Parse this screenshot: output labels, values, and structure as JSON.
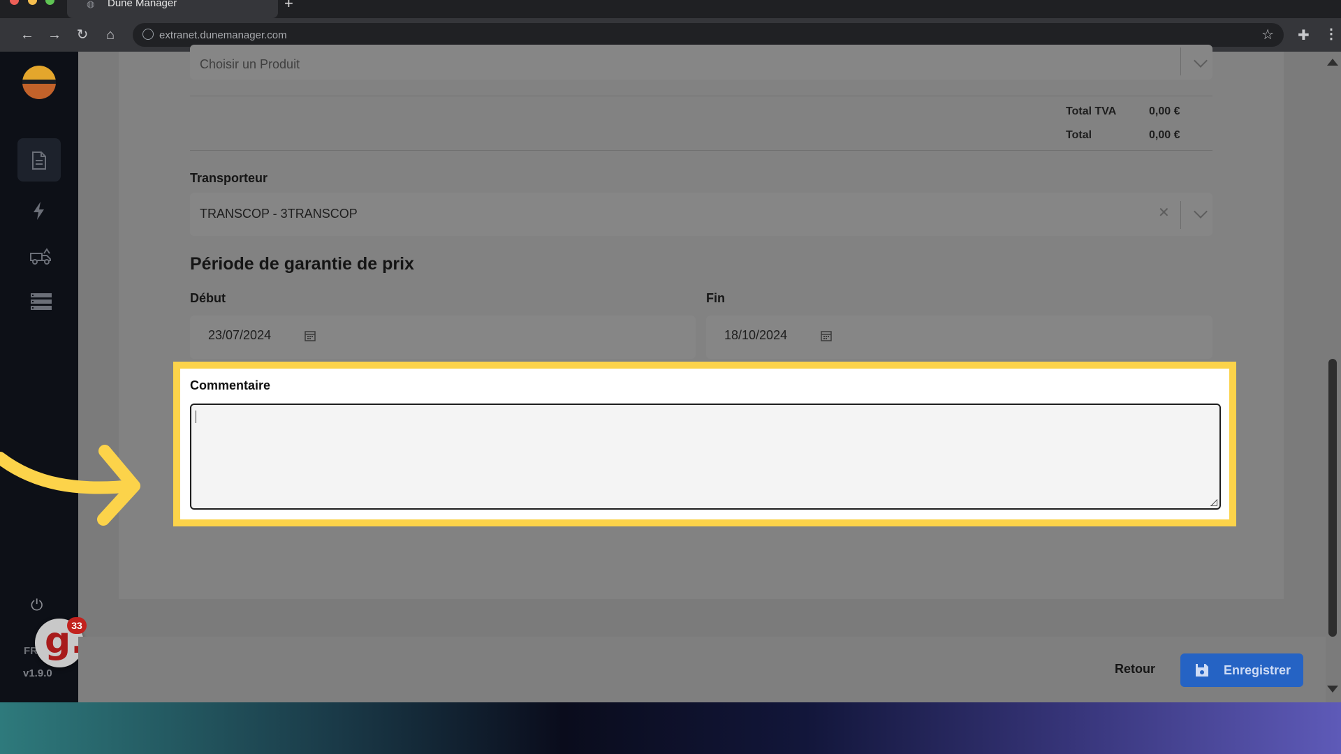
{
  "browser": {
    "tab_title": "Dune Manager",
    "new_tab_symbol": "+",
    "url": "extranet.dunemanager.com"
  },
  "sidebar": {
    "items": [
      {
        "name": "documents",
        "icon": "document-icon",
        "active": true
      },
      {
        "name": "lightning",
        "icon": "lightning-icon",
        "active": false
      },
      {
        "name": "truck",
        "icon": "truck-icon",
        "active": false
      },
      {
        "name": "list",
        "icon": "list-icon",
        "active": false
      }
    ],
    "language": "FR",
    "version": "v1.9.0",
    "badge_count": "33",
    "avatar_letter": "g."
  },
  "form": {
    "product_placeholder": "Choisir un Produit",
    "totals": [
      {
        "label": "Total TVA",
        "value": "0,00 €"
      },
      {
        "label": "Total",
        "value": "0,00 €"
      }
    ],
    "transporter_label": "Transporteur",
    "transporter_value": "TRANSCOP - 3TRANSCOP",
    "price_period_title": "Période de garantie de prix",
    "start_label": "Début",
    "start_value": "23/07/2024",
    "end_label": "Fin",
    "end_value": "18/10/2024",
    "comment_label": "Commentaire",
    "comment_value": ""
  },
  "footer": {
    "back_label": "Retour",
    "save_label": "Enregistrer"
  },
  "colors": {
    "highlight": "#fcd34a",
    "primary_button": "#2563c4",
    "sidebar_bg": "#0d1017"
  }
}
